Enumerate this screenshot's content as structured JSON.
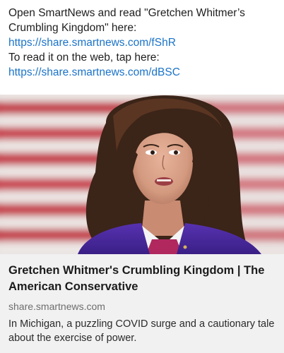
{
  "message": {
    "line1_prefix": "Open SmartNews and read \"Gretchen Whitmer’s Crumbling Kingdom\" here: ",
    "link1": "https://share.smartnews.com/fShR",
    "line2_prefix": "To read it on the web, tap here: ",
    "link2": "https://share.smartnews.com/dBSC"
  },
  "preview": {
    "image_description": "photo of woman in purple blazer in front of American flag",
    "title": "Gretchen Whitmer's Crumbling Kingdom | The American Conservative",
    "domain": "share.smartnews.com",
    "description": "In Michigan, a puzzling COVID surge and a cautionary tale about the exercise of power."
  },
  "colors": {
    "link": "#1a73c8",
    "card_background": "#f1f1f1",
    "blazer": "#4a2a9c"
  }
}
